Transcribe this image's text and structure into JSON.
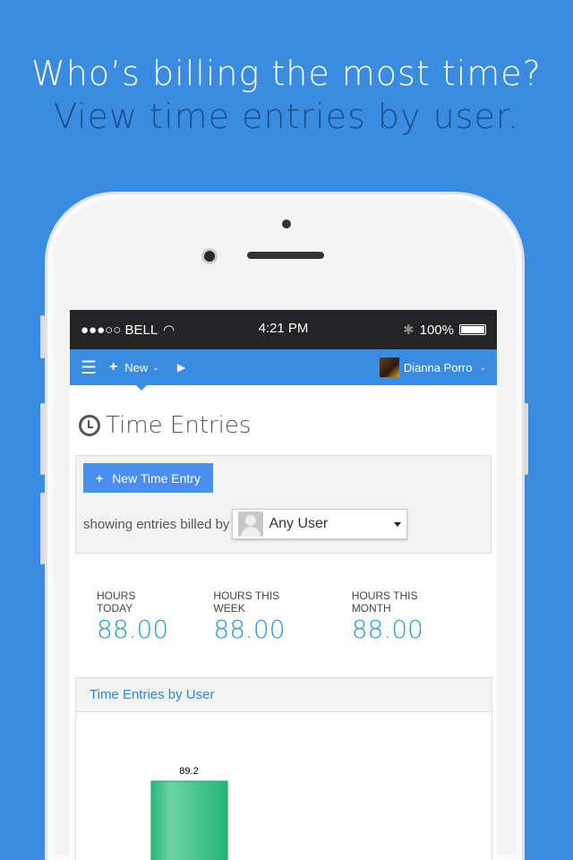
{
  "headline": {
    "line1": "Who’s billing the most time?",
    "line2": "View time entries by user."
  },
  "status_bar": {
    "carrier": "●●●○○ BELL",
    "time": "4:21 PM",
    "battery": "100%"
  },
  "nav": {
    "new_label": "New",
    "user_name": "Dianna Porro"
  },
  "page": {
    "title": "Time Entries",
    "new_button": "New Time Entry",
    "filter_label": "showing entries billed by",
    "filter_value": "Any User"
  },
  "stats": [
    {
      "label": "HOURS TODAY",
      "value": "88.00"
    },
    {
      "label": "HOURS THIS WEEK",
      "value": "88.00"
    },
    {
      "label": "HOURS THIS MONTH",
      "value": "88.00"
    }
  ],
  "chart_data": {
    "type": "bar",
    "title": "Time Entries by User",
    "values": [
      89.2
    ],
    "data_labels": [
      "89.2"
    ],
    "color": "#27b87a"
  }
}
